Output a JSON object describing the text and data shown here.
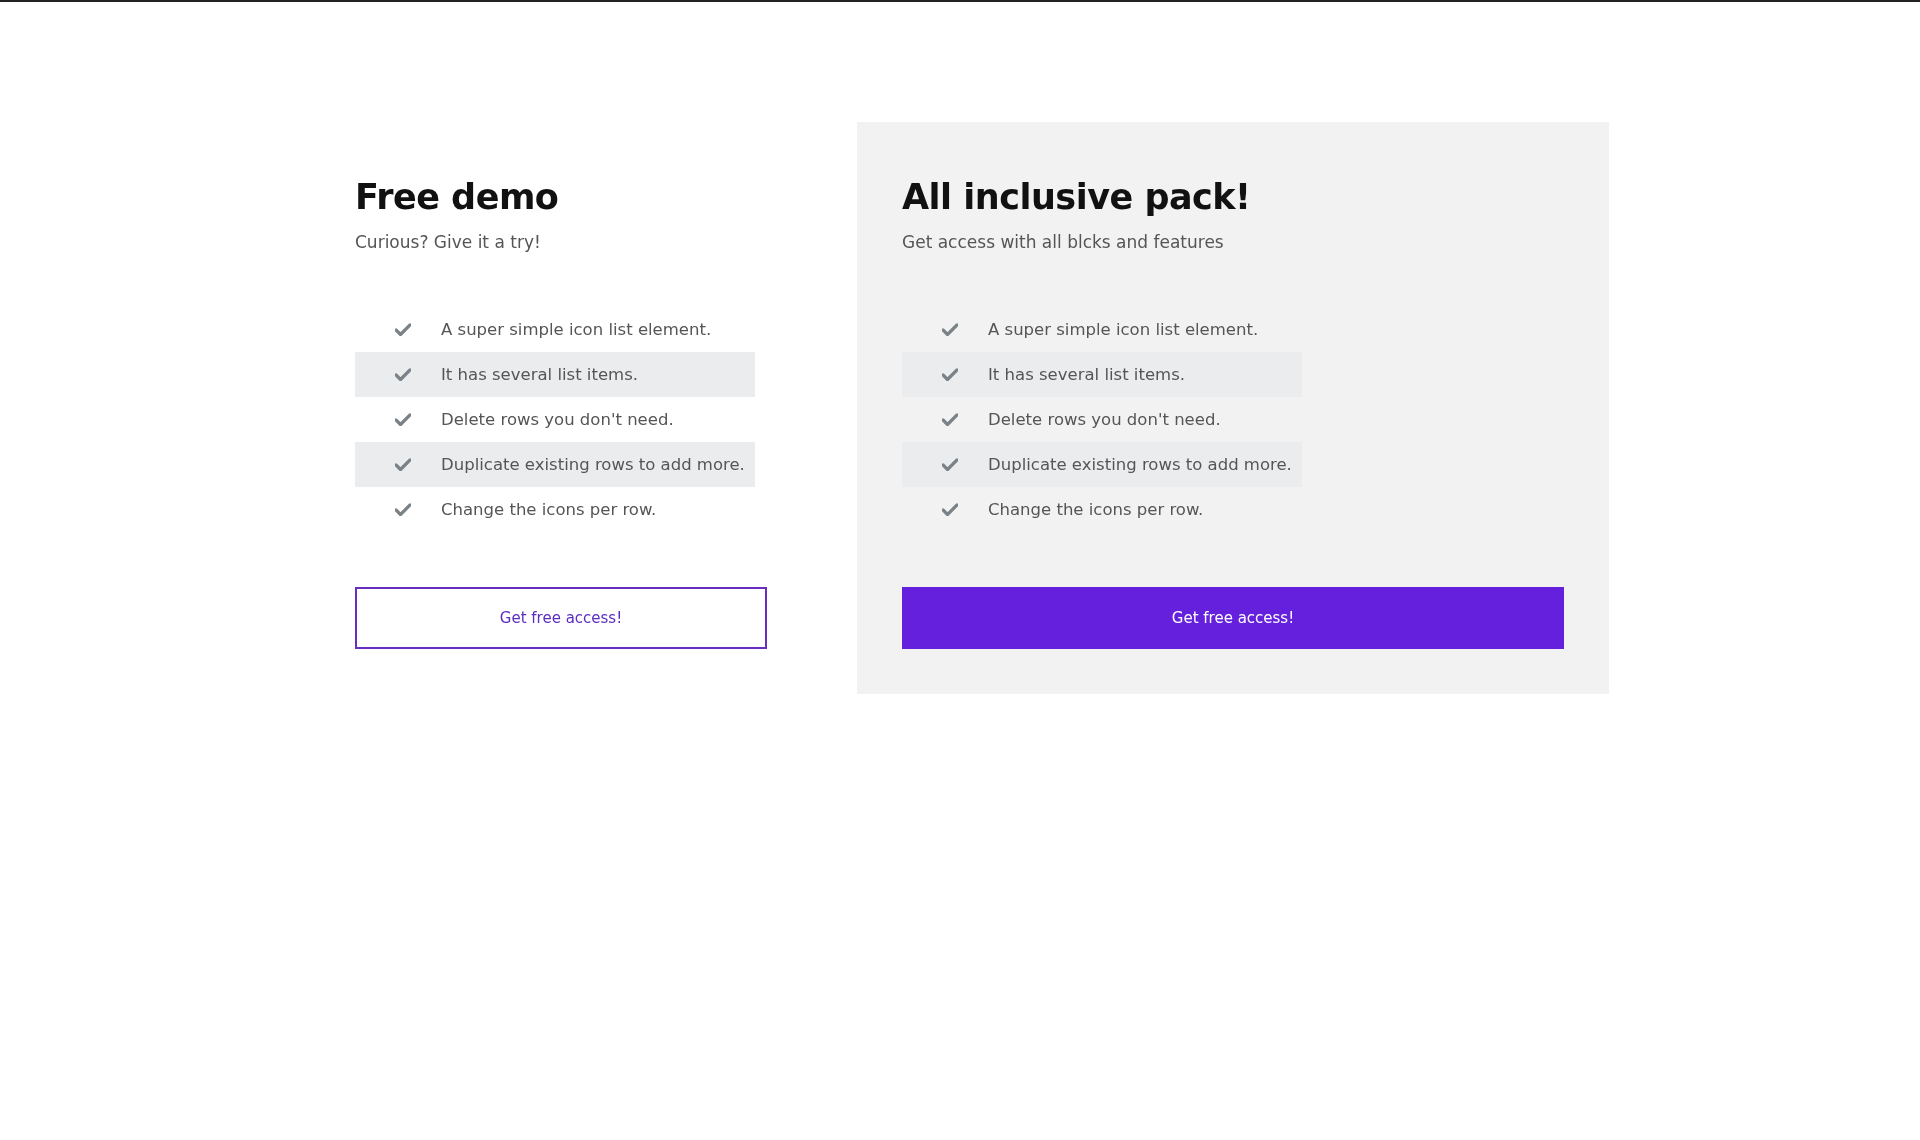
{
  "plans": [
    {
      "kind": "plain",
      "title": "Free demo",
      "subtitle": "Curious? Give it a try!",
      "features": [
        "A super simple icon list element.",
        "It has several list items.",
        "Delete rows you don't need.",
        "Duplicate existing rows to add more.",
        "Change the icons per row."
      ],
      "button": {
        "label": "Get free access!",
        "kind": "outline"
      }
    },
    {
      "kind": "featured",
      "title": "All inclusive pack!",
      "subtitle": "Get access with all blcks and features",
      "features": [
        "A super simple icon list element.",
        "It has several list items.",
        "Delete rows you don't need.",
        "Duplicate existing rows to add more.",
        "Change the icons per row."
      ],
      "button": {
        "label": "Get free access!",
        "kind": "filled"
      }
    }
  ]
}
